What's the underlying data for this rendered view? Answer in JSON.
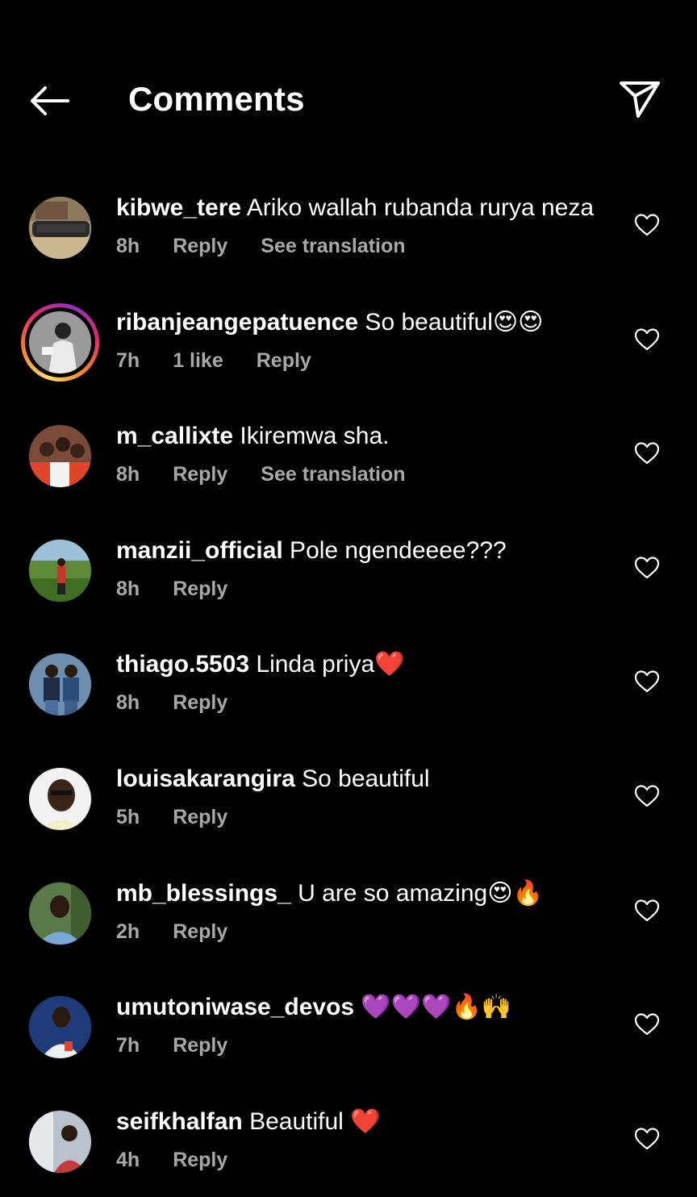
{
  "header": {
    "title": "Comments"
  },
  "colors": {
    "background": "#000000",
    "text": "#ffffff",
    "meta": "#a8a8a8"
  },
  "comments": [
    {
      "username": "kibwe_tere",
      "text": " Ariko wallah rubanda rurya neza",
      "time": "8h",
      "likes": "",
      "reply": "Reply",
      "translation": "See translation",
      "story": false
    },
    {
      "username": "ribanjeangepatuence",
      "text": " So beautiful😍😍",
      "time": "7h",
      "likes": "1 like",
      "reply": "Reply",
      "translation": "",
      "story": true
    },
    {
      "username": "m_callixte",
      "text": " Ikiremwa sha.",
      "time": "8h",
      "likes": "",
      "reply": "Reply",
      "translation": "See translation",
      "story": false
    },
    {
      "username": "manzii_official",
      "text": " Pole ngendeeee???",
      "time": "8h",
      "likes": "",
      "reply": "Reply",
      "translation": "",
      "story": false
    },
    {
      "username": "thiago.5503",
      "text": " Linda priya❤️",
      "time": "8h",
      "likes": "",
      "reply": "Reply",
      "translation": "",
      "story": false
    },
    {
      "username": "louisakarangira",
      "text": " So beautiful",
      "time": "5h",
      "likes": "",
      "reply": "Reply",
      "translation": "",
      "story": false
    },
    {
      "username": "mb_blessings_",
      "text": " U are so amazing😍🔥",
      "time": "2h",
      "likes": "",
      "reply": "Reply",
      "translation": "",
      "story": false
    },
    {
      "username": "umutoniwase_devos",
      "text": " 💜💜💜🔥🙌",
      "time": "7h",
      "likes": "",
      "reply": "Reply",
      "translation": "",
      "story": false
    },
    {
      "username": "seifkhalfan",
      "text": " Beautiful ❤️",
      "time": "4h",
      "likes": "",
      "reply": "Reply",
      "translation": "",
      "story": false
    }
  ]
}
